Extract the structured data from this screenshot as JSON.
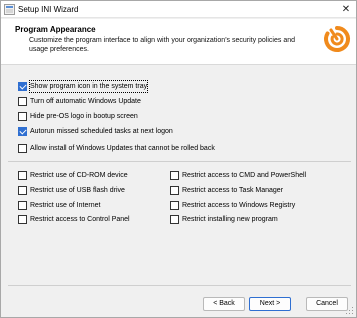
{
  "window": {
    "title": "Setup INI Wizard",
    "close_glyph": "✕"
  },
  "header": {
    "title": "Program Appearance",
    "description": "Customize the program interface to align with your organization’s security policies and usage preferences.",
    "logo_icon": "power-swirl-icon",
    "logo_color": "#f08a1c"
  },
  "options": {
    "top_group": [
      {
        "label": "Show program icon in the system tray",
        "checked": true,
        "focused": true
      },
      {
        "label": "Turn off automatic Windows Update",
        "checked": false
      },
      {
        "label": "Hide pre-OS logo in bootup screen",
        "checked": false
      },
      {
        "label": "Autorun missed scheduled tasks at next logon",
        "checked": true
      },
      {
        "label": "Allow install of Windows Updates that cannot be rolled back",
        "checked": false
      }
    ],
    "left_column": [
      {
        "label": "Restrict use of CD-ROM device",
        "checked": false
      },
      {
        "label": "Restrict use of USB flash drive",
        "checked": false
      },
      {
        "label": "Restrict use of Internet",
        "checked": false
      },
      {
        "label": "Restrict access to Control Panel",
        "checked": false
      }
    ],
    "right_column": [
      {
        "label": "Restrict access to CMD and PowerShell",
        "checked": false
      },
      {
        "label": "Restrict access to Task Manager",
        "checked": false
      },
      {
        "label": "Restrict access to Windows Registry",
        "checked": false
      },
      {
        "label": "Restrict installing new program",
        "checked": false
      }
    ]
  },
  "buttons": {
    "back": "< Back",
    "next": "Next >",
    "cancel": "Cancel"
  },
  "colors": {
    "accent": "#2f6fd1",
    "window_bg": "#f0f0f0"
  }
}
